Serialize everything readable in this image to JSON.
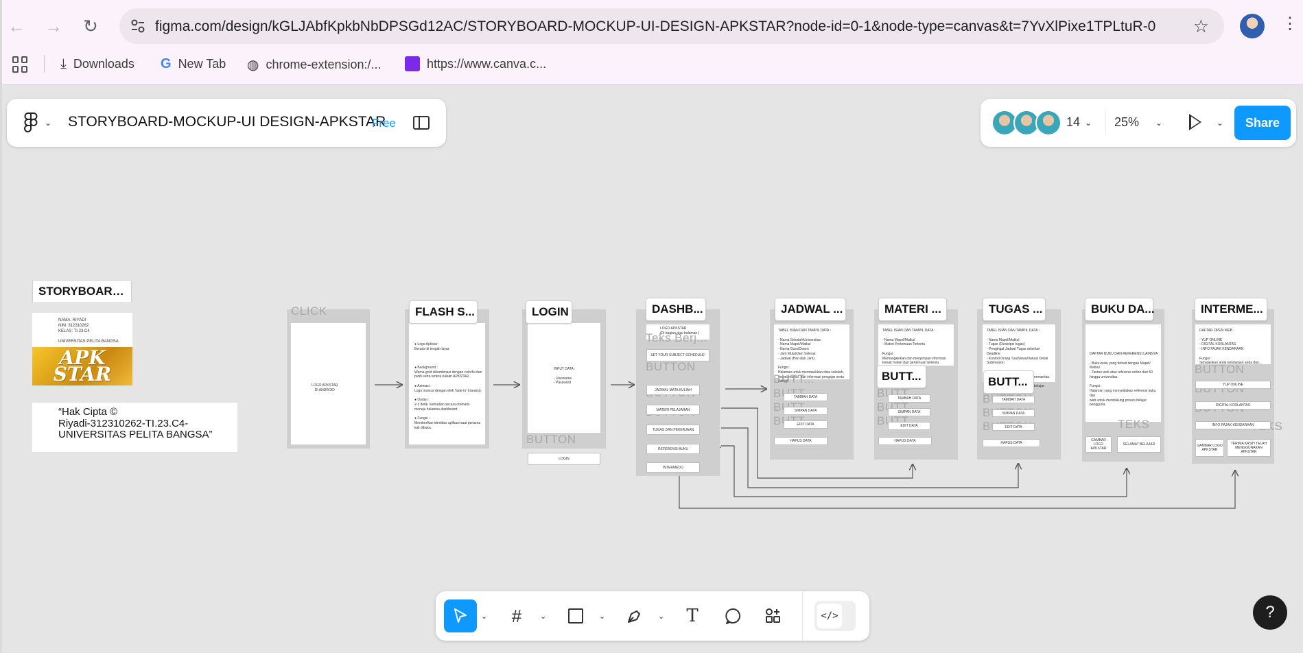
{
  "browser": {
    "url": "figma.com/design/kGLJAbfKpkbNbDPSGd12AC/STORYBOARD-MOCKUP-UI-DESIGN-APKSTAR?node-id=0-1&node-type=canvas&t=7YvXlPixe1TPLtuR-0",
    "bookmarks": [
      "Downloads",
      "New Tab",
      "chrome-extension:/...",
      "https://www.canva.c..."
    ]
  },
  "figma": {
    "file_title": "STORYBOARD-MOCKUP-UI DESIGN-APKSTAR",
    "plan_badge": "Free",
    "collaborator_count": "14",
    "zoom": "25%",
    "share_label": "Share",
    "help_label": "?"
  },
  "storyboard": {
    "title": "STORYBOARD...",
    "info": "NAMA: RIYADI\nNIM: 312310262\nKELAS: TI.23.C4\n\nUNIVERSITAS PELITA BANGSA",
    "logo_text": "APK\nSTAR",
    "copyright": "“Hak Cipta ©\nRiyadi-312310262-TI.23.C4-\nUNIVERSITAS PELITA BANGSA”"
  },
  "frames": {
    "click": {
      "ghost": "CLICK",
      "screen_text": "LOGO APKSTAR\nDI ANDROID"
    },
    "flash": {
      "tag": "FLASH S...",
      "screen_text": "● Logo Apkstar :\n   Berada di tengah layar.\n\n\n\n● Background :\n   Warna gold dikombinasi dengan colorful dan\n   putih serta tertera tulisan APKSTAR.\n\n● Animasi :\n   Logo muncul dengan efek 'fade-in' (transisi).\n\n● Durasi :\n   2-3 detik, kemudian secara otomatis\n   menuju halaman dashboard.\n\n● Fungsi :\n   Memberikan identitas aplikasi saat pertama\n   kali dibuka."
    },
    "login": {
      "tag": "LOGIN",
      "screen_text": "INPUT DATA :\n\n- Username\n- Password",
      "ghost": "BUTTON",
      "button": "LOGIN"
    },
    "dashboard": {
      "tag": "DASHB...",
      "header": "LOGO APKSTAR\n(Di bagian atas halaman.)",
      "ghost_teks": "Teks Berj...",
      "ghost_button": "BUTTON",
      "buttons": [
        "SET YOUR SUBJECT SCHEDULE!",
        "JADWAL MATA KULIAH",
        "MATERI PELAJARAN",
        "TUGAS DAN PEKERJAAN",
        "REFERENSI BUKU",
        "INTERMEDO"
      ]
    },
    "jadwal": {
      "tag": "JADWAL ...",
      "screen_text": "TABEL ISIAN DAN TAMPIL DATA :\n\n- Nama Sekolah/Universitas\n- Nama Mapel/Matkul\n- Nama Guru/Dosen\n- Jam Mulai/Jam Selesai\n- Jadwal (Hari dan Jam)\n\nFungsi :\nHalaman untuk memasukkan data sekolah,\nmapel/matkul, dan informasi pengajar serta\njadwal.",
      "ghost": "BUTT...",
      "buttons": [
        "TAMBAH DATA",
        "SIMPAN DATA",
        "EDIT DATA",
        "HAPUS DATA"
      ]
    },
    "materi": {
      "tag": "MATERI ...",
      "butt_tag": "BUTT...",
      "screen_text": "TABEL ISIAN DAN TAMPIL DATA :\n\n- Nama Mapel/Matkul\n- Materi Pertemuan Tertentu\n\nFungsi :\nMemungkinkan dan menyimpan informasi\nterkait materi dari pertemuan tertentu.",
      "ghost": "BUTT...",
      "buttons": [
        "TAMBAH DATA",
        "SIMPAN DATA",
        "EDIT DATA",
        "HAPUS DATA"
      ]
    },
    "tugas": {
      "tag": "TUGAS ...",
      "butt_tag": "BUTT...",
      "screen_text": "TABEL ISIAN DAN TAMPIL DATA :\n\n- Nama Mapel/Matkul\n- Tugas (Deskripsi tugas)\n- Pengingat Jadwal Tugas sebelum\n   Deadline\n- Kontrol Orang Tua/Siswa/Variasi Detail\n   Submission\n\nFungsi :\nMembantu mengingatkan dan memantau\ntugas sekolah atau kuliah serta\nmendorong siswa untuk kuliah/belajar\ndengan baik.",
      "ghost": "BUTTON",
      "buttons": [
        "TAMBAH DATA",
        "SIMPAN DATA",
        "EDIT DATA",
        "HAPUS DATA"
      ]
    },
    "buku": {
      "tag": "BUKU DA...",
      "screen_text": "DAFTAR BUKU DAN REFERENSI LAINNYA :\n\n- Buku-buku yang terkait dengan Mapel/\n   Matkul\n- Tautan web atau referensi online dari 50\n   hingga universitas.\n\nFungsi :\nHalaman yang menyediakan referensi buku dan\nweb untuk mendukung proses belajar\npengguna.",
      "ghost": "TEKS",
      "cells": [
        "GAMBAR LOGO APKSTAR",
        "SELAMAT BELAJAR"
      ]
    },
    "intermezo": {
      "tag": "INTERME...",
      "screen_text": "DAFTAR OPEN WEB :\n\n- YUP ONLINE\n- DIGITAL KORLANTAS\n- INFO PAJAK KENDARAAN\n\nFungsi :\nSimulasikan anda kendaraan anda dan...",
      "ghost_button": "BUTTON",
      "ghost_teks": "TEKS",
      "buttons": [
        "YUP ONLINE",
        "DIGITAL KORLANTAS",
        "INFO PAJAK KENDARAAN"
      ],
      "cells": [
        "GAMBAR LOGO APKSTAR",
        "TERIMA KASIH TELAH MENGGUNAKAN APKSTAR"
      ]
    }
  },
  "toolbar": {
    "tools": [
      "move-tool",
      "frame-tool",
      "rectangle-tool",
      "pen-tool",
      "text-tool",
      "comment-tool",
      "actions-tool"
    ]
  },
  "colors": {
    "accent": "#0d99ff",
    "canvas": "#e5e5e5",
    "frame_gray": "#cfcfcf"
  }
}
